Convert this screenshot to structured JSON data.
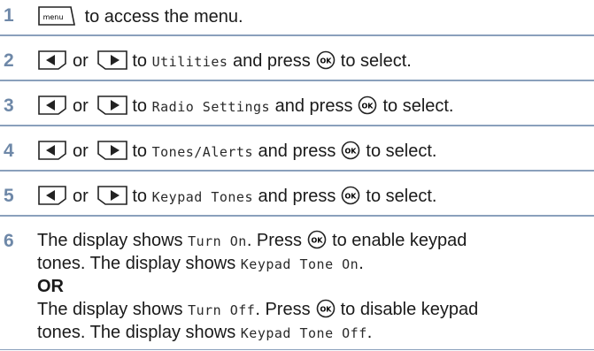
{
  "colors": {
    "step_number": "#6e88a8",
    "rule": "#8aa0bc",
    "text": "#1a1a1a"
  },
  "icons": {
    "menu_key": "menu-key-icon",
    "left_key": "left-arrow-key-icon",
    "right_key": "right-arrow-key-icon",
    "ok_key": "ok-key-icon"
  },
  "menu_key_label": "menu",
  "ok_key_label": "OK",
  "steps": [
    {
      "number": "1",
      "text": "to access the menu."
    },
    {
      "number": "2",
      "or": "or",
      "to": "to",
      "item": "Utilities",
      "tail1": "and press",
      "tail2": "to select."
    },
    {
      "number": "3",
      "or": "or",
      "to": "to",
      "item": "Radio Settings",
      "tail1": "and press",
      "tail2": "to select."
    },
    {
      "number": "4",
      "or": "or",
      "to": "to",
      "item": "Tones/Alerts",
      "tail1": "and press",
      "tail2": "to select."
    },
    {
      "number": "5",
      "or": "or",
      "to": "to",
      "item": "Keypad Tones",
      "tail1": "and press",
      "tail2": "to select."
    },
    {
      "number": "6",
      "a1": "The display shows",
      "a_disp": "Turn On",
      "a2": ". Press",
      "a3": "to enable keypad",
      "a4": "tones. The display shows",
      "a_disp2": "Keypad Tone On",
      "a5": ".",
      "or_label": "OR",
      "b1": "The display shows",
      "b_disp": "Turn Off",
      "b2": ". Press",
      "b3": "to disable keypad",
      "b4": "tones. The display shows",
      "b_disp2": "Keypad Tone Off",
      "b5": "."
    }
  ]
}
